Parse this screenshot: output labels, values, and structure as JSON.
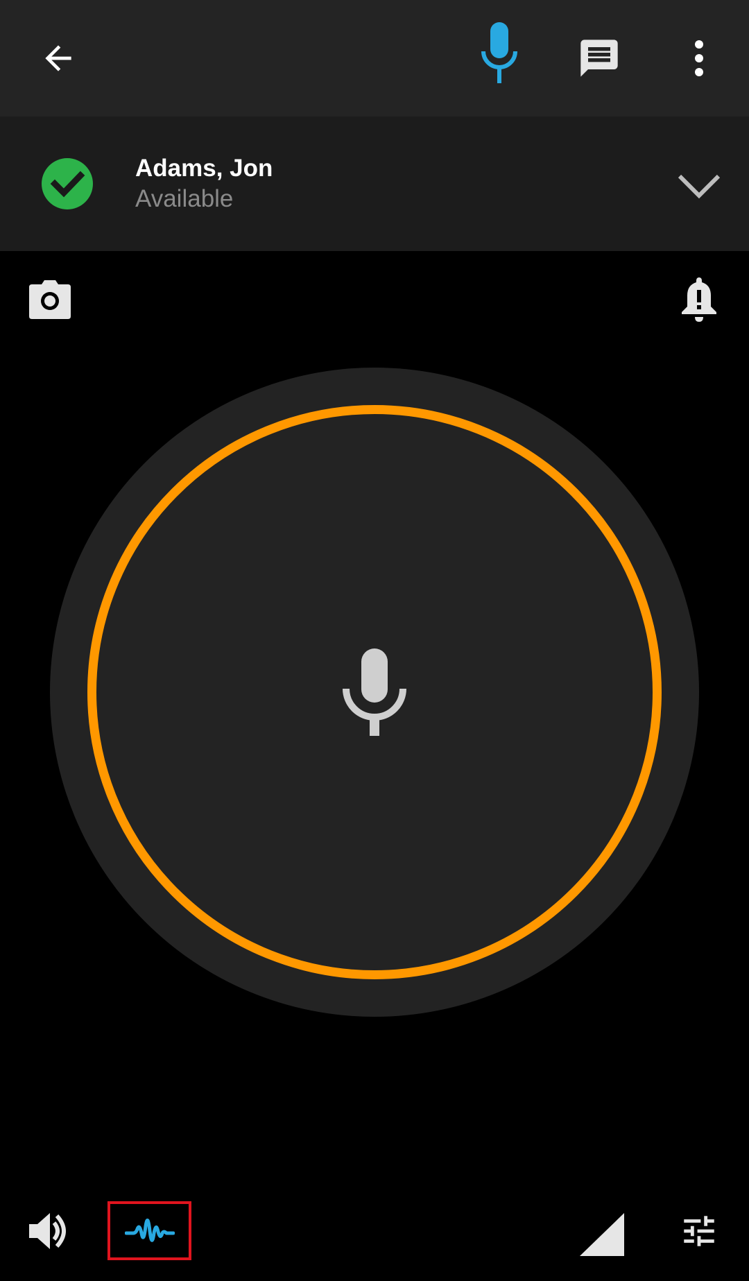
{
  "toolbar": {
    "icons": {
      "back": "back-arrow-icon",
      "mic": "microphone-icon",
      "message": "message-icon",
      "more": "more-vert-icon"
    },
    "mic_color": "#29a9e1"
  },
  "contact": {
    "name": "Adams, Jon",
    "status": "Available",
    "status_color": "#2db34a"
  },
  "ptt": {
    "ring_color": "#ff9800",
    "icon": "microphone-icon"
  },
  "bottom_bar": {
    "icons": [
      "volume-icon",
      "waveform-icon",
      "signal-icon",
      "tune-icon"
    ],
    "waveform_color": "#29a9e1",
    "waveform_highlight_color": "#e0141e"
  }
}
